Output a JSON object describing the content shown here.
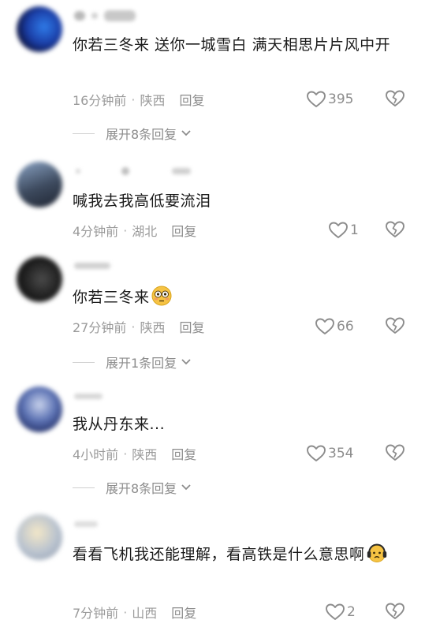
{
  "comments": [
    {
      "text": "你若三冬来  送你一城雪白  满天相思片片风中开",
      "time": "16分钟前",
      "location": "陕西",
      "reply_label": "回复",
      "likes": "395",
      "expand_label": "展开8条回复"
    },
    {
      "text": "喊我去我高低要流泪",
      "time": "4分钟前",
      "location": "湖北",
      "reply_label": "回复",
      "likes": "1"
    },
    {
      "text": "你若三冬来",
      "emoji": "flushed-face-emoji",
      "time": "27分钟前",
      "location": "陕西",
      "reply_label": "回复",
      "likes": "66",
      "expand_label": "展开1条回复"
    },
    {
      "text": "我从丹东来...",
      "time": "4小时前",
      "location": "陕西",
      "reply_label": "回复",
      "likes": "354",
      "expand_label": "展开8条回复"
    },
    {
      "text": "看看飞机我还能理解，看高铁是什么意思啊",
      "emoji": "headphones-worried-face-emoji",
      "time": "7分钟前",
      "location": "山西",
      "reply_label": "回复",
      "likes": "2"
    }
  ],
  "icons": {
    "like": "heart-outline-icon",
    "dislike": "broken-heart-icon",
    "expand": "chevron-down-icon"
  },
  "colors": {
    "text": "#1a1a1a",
    "meta": "#9a9a9a",
    "icon": "#8c8c8c"
  }
}
